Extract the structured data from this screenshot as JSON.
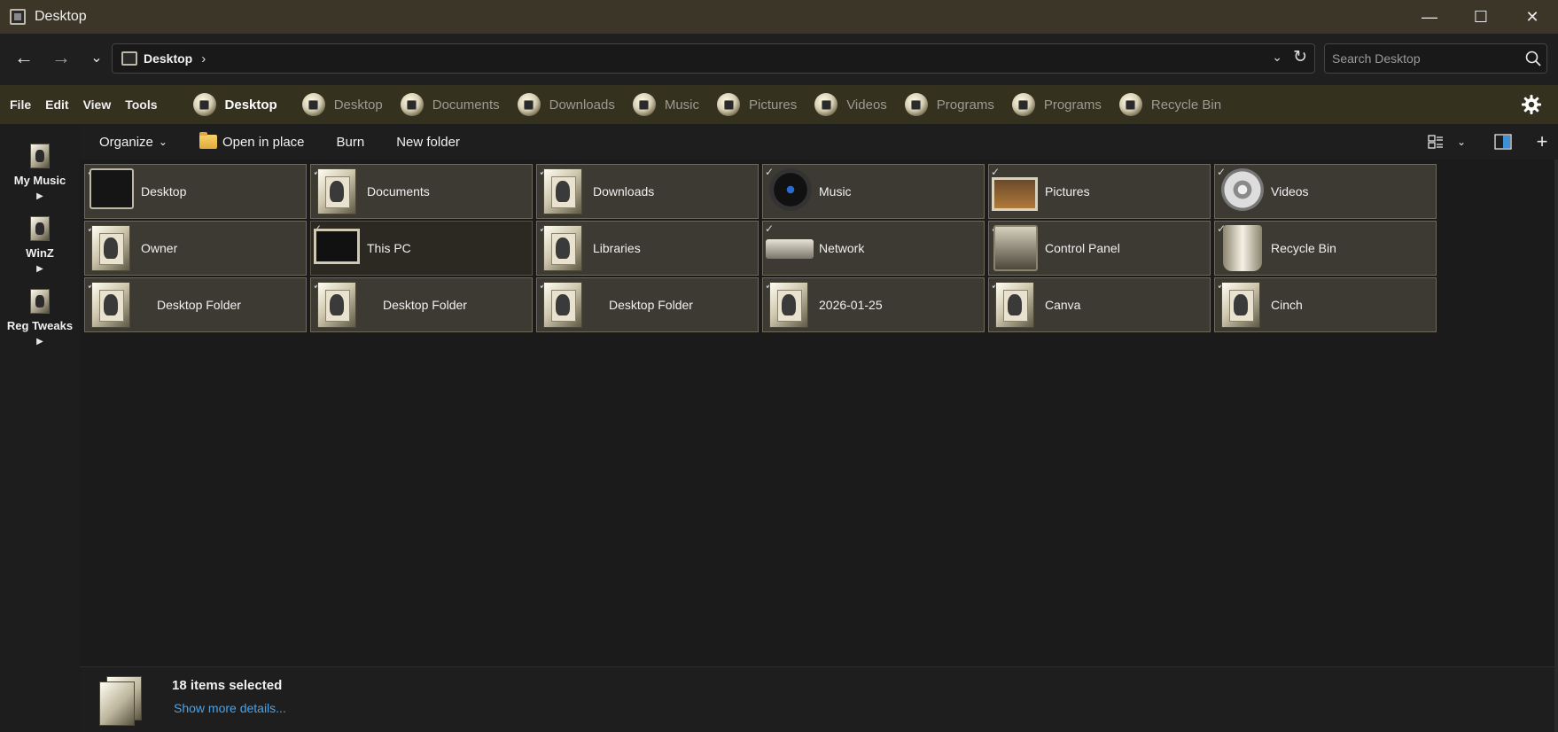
{
  "window": {
    "title": "Desktop",
    "controls": {
      "minimize": "—",
      "maximize": "☐",
      "close": "✕"
    }
  },
  "nav": {
    "back": "←",
    "forward": "→",
    "recent": "⌄"
  },
  "address": {
    "crumb": "Desktop",
    "separator": "›",
    "dropdown": "⌄",
    "refresh": "↻"
  },
  "search": {
    "placeholder": "Search Desktop"
  },
  "menu": {
    "items": [
      "File",
      "Edit",
      "View",
      "Tools"
    ]
  },
  "favorites": [
    {
      "label": "Desktop",
      "active": true
    },
    {
      "label": "Desktop"
    },
    {
      "label": "Documents"
    },
    {
      "label": "Downloads"
    },
    {
      "label": "Music"
    },
    {
      "label": "Pictures"
    },
    {
      "label": "Videos"
    },
    {
      "label": "Programs"
    },
    {
      "label": "Programs"
    },
    {
      "label": "Recycle Bin"
    }
  ],
  "leftpane": {
    "items": [
      {
        "label": "My Music",
        "arrow": "▶"
      },
      {
        "label": "WinZ",
        "arrow": "▶"
      },
      {
        "label": "Reg Tweaks",
        "arrow": "▶"
      }
    ]
  },
  "commands": {
    "organize": "Organize",
    "organize_caret": "⌄",
    "open_in_place": "Open in place",
    "burn": "Burn",
    "new_folder": "New folder",
    "view_caret": "⌄",
    "add": "+"
  },
  "items": [
    {
      "label": "Desktop",
      "icon": "desktop-icon"
    },
    {
      "label": "Documents",
      "icon": "documents-icon"
    },
    {
      "label": "Downloads",
      "icon": "downloads-icon"
    },
    {
      "label": "Music",
      "icon": "music-icon"
    },
    {
      "label": "Pictures",
      "icon": "pictures-icon"
    },
    {
      "label": "Videos",
      "icon": "videos-icon"
    },
    {
      "label": "Owner",
      "icon": "folder-icon"
    },
    {
      "label": "This PC",
      "icon": "computer-icon"
    },
    {
      "label": "Libraries",
      "icon": "folder-icon"
    },
    {
      "label": "Network",
      "icon": "network-icon"
    },
    {
      "label": "Control Panel",
      "icon": "control-panel-icon"
    },
    {
      "label": "Recycle Bin",
      "icon": "recycle-bin-icon"
    },
    {
      "label": "Desktop Folder",
      "icon": "folder-icon"
    },
    {
      "label": "Desktop Folder",
      "icon": "folder-icon"
    },
    {
      "label": "Desktop Folder",
      "icon": "folder-icon"
    },
    {
      "label": "2026-01-25",
      "icon": "folder-icon"
    },
    {
      "label": "Canva",
      "icon": "folder-icon"
    },
    {
      "label": "Cinch",
      "icon": "folder-icon"
    }
  ],
  "check_mark": "✓",
  "details": {
    "count": "18 items selected",
    "link": "Show more details..."
  },
  "colors": {
    "accent": "#4aa3e8",
    "titlebar": "#3b3628",
    "menubar": "#35311f",
    "tile": "#3c3a33"
  }
}
